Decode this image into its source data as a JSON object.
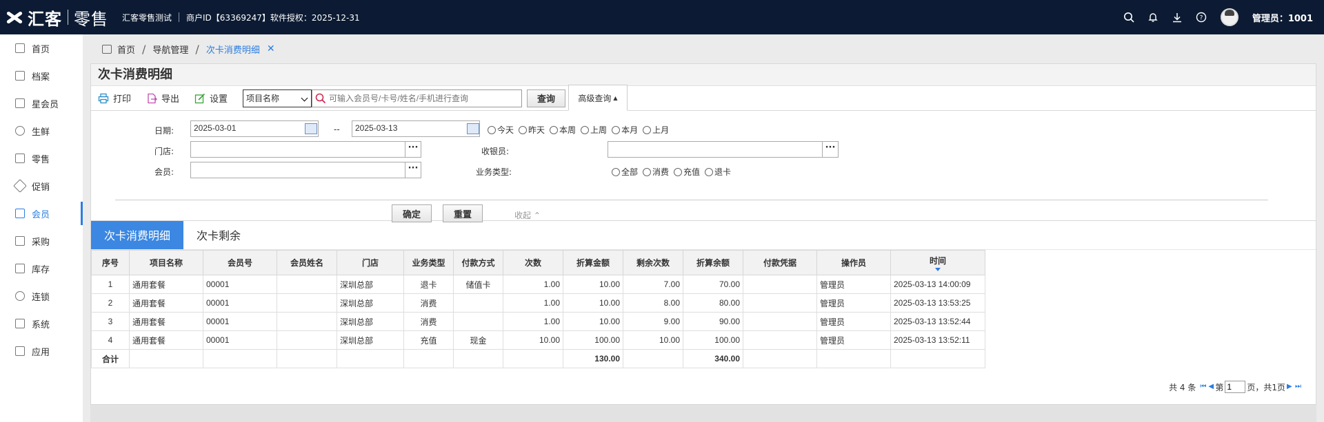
{
  "header": {
    "logo_text": "汇客",
    "logo_sub": "零售",
    "store_name": "汇客零售测试",
    "merchant_info": "商户ID【63369247】软件授权：2025-12-31",
    "admin_label": "管理员：1001",
    "icons": [
      "search-icon",
      "bell-icon",
      "download-icon",
      "help-icon"
    ]
  },
  "sidebar": {
    "items": [
      {
        "label": "首页",
        "icon": "home-icon"
      },
      {
        "label": "档案",
        "icon": "archive-icon"
      },
      {
        "label": "星会员",
        "icon": "star-member-icon"
      },
      {
        "label": "生鲜",
        "icon": "fresh-icon"
      },
      {
        "label": "零售",
        "icon": "retail-icon"
      },
      {
        "label": "促销",
        "icon": "tag-icon"
      },
      {
        "label": "会员",
        "icon": "member-icon"
      },
      {
        "label": "采购",
        "icon": "cart-icon"
      },
      {
        "label": "库存",
        "icon": "warehouse-icon"
      },
      {
        "label": "连锁",
        "icon": "chain-icon"
      },
      {
        "label": "系统",
        "icon": "system-icon"
      },
      {
        "label": "应用",
        "icon": "app-icon"
      }
    ],
    "active": "会员"
  },
  "breadcrumb": {
    "home": "首页",
    "nav": "导航管理",
    "current": "次卡消费明细"
  },
  "panel": {
    "title": "次卡消费明细",
    "toolbar": {
      "print": "打印",
      "export": "导出",
      "settings": "设置",
      "select_value": "项目名称",
      "search_placeholder": "可输入会员号/卡号/姓名/手机进行查询",
      "query": "查询",
      "advanced": "高级查询"
    },
    "form": {
      "date_label": "日期:",
      "date_from": "2025-03-01",
      "date_sep": "--",
      "date_to": "2025-03-13",
      "date_options": [
        "今天",
        "昨天",
        "本周",
        "上周",
        "本月",
        "上月"
      ],
      "store_label": "门店:",
      "cashier_label": "收银员:",
      "member_label": "会员:",
      "biz_type_label": "业务类型:",
      "biz_type_options": [
        "全部",
        "消费",
        "充值",
        "退卡"
      ],
      "confirm": "确定",
      "reset": "重置",
      "collapse": "收起"
    },
    "tabs": [
      "次卡消费明细",
      "次卡剩余"
    ],
    "table": {
      "columns": [
        "序号",
        "项目名称",
        "会员号",
        "会员姓名",
        "门店",
        "业务类型",
        "付款方式",
        "次数",
        "折算金额",
        "剩余次数",
        "折算余额",
        "付款凭据",
        "操作员",
        "时间"
      ],
      "rows": [
        [
          "1",
          "通用套餐",
          "00001",
          "",
          "深圳总部",
          "退卡",
          "储值卡",
          "1.00",
          "10.00",
          "7.00",
          "70.00",
          "",
          "管理员",
          "2025-03-13 14:00:09"
        ],
        [
          "2",
          "通用套餐",
          "00001",
          "",
          "深圳总部",
          "消费",
          "",
          "1.00",
          "10.00",
          "8.00",
          "80.00",
          "",
          "管理员",
          "2025-03-13 13:53:25"
        ],
        [
          "3",
          "通用套餐",
          "00001",
          "",
          "深圳总部",
          "消费",
          "",
          "1.00",
          "10.00",
          "9.00",
          "90.00",
          "",
          "管理员",
          "2025-03-13 13:52:44"
        ],
        [
          "4",
          "通用套餐",
          "00001",
          "",
          "深圳总部",
          "充值",
          "现金",
          "10.00",
          "100.00",
          "10.00",
          "100.00",
          "",
          "管理员",
          "2025-03-13 13:52:11"
        ]
      ],
      "total_row": [
        "合计",
        "",
        "",
        "",
        "",
        "",
        "",
        "",
        "130.00",
        "",
        "340.00",
        "",
        "",
        ""
      ]
    },
    "pager": {
      "total_text": "共 4 条",
      "page_prefix": "第",
      "page_value": "1",
      "page_suffix": "页，共1页"
    }
  }
}
